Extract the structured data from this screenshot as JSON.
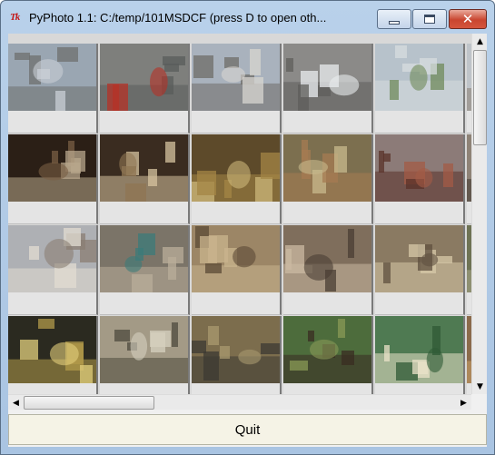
{
  "window": {
    "app_icon": "Tk",
    "title": "PyPhoto 1.1: C:/temp/101MSDCF  (press D to open oth...",
    "minimize_icon": "minimize-icon",
    "maximize_icon": "maximize-icon",
    "close_icon": "close-icon",
    "close_glyph": "✕"
  },
  "thumbnails": [
    {
      "row": 0,
      "col": 0,
      "subject": "london-aerial-skyline",
      "bg": "#9aa6b2",
      "fg": "#6e6f6e",
      "accent": "#c9cfd6"
    },
    {
      "row": 0,
      "col": 1,
      "subject": "street-with-red-buses",
      "bg": "#7e7f7c",
      "fg": "#5a5c5b",
      "accent": "#b53127"
    },
    {
      "row": 0,
      "col": 2,
      "subject": "bridge-over-thames",
      "bg": "#a9b2bd",
      "fg": "#6f6c68",
      "accent": "#d8d6d0"
    },
    {
      "row": 0,
      "col": 3,
      "subject": "aerial-rooftops",
      "bg": "#8b8a88",
      "fg": "#5f5d5b",
      "accent": "#e9ecef"
    },
    {
      "row": 0,
      "col": 4,
      "subject": "office-building-rooftop",
      "bg": "#b7c2cb",
      "fg": "#d7dcdf",
      "accent": "#6f8a5a"
    },
    {
      "row": 0,
      "col": 5,
      "subject": "street-buildings",
      "bg": "#bfc4c9",
      "fg": "#8a7f72",
      "accent": "#a63a2e"
    },
    {
      "row": 1,
      "col": 0,
      "subject": "museum-sculptures",
      "bg": "#2b1f16",
      "fg": "#b8a78c",
      "accent": "#7a5f44"
    },
    {
      "row": 1,
      "col": 1,
      "subject": "temple-columns",
      "bg": "#3a2c20",
      "fg": "#d6c39f",
      "accent": "#8f7653"
    },
    {
      "row": 1,
      "col": 2,
      "subject": "bronze-helmet",
      "bg": "#5d4a2a",
      "fg": "#a48645",
      "accent": "#cbb57a"
    },
    {
      "row": 1,
      "col": 3,
      "subject": "clay-pot-display",
      "bg": "#7c6f4f",
      "fg": "#a67b52",
      "accent": "#c8b98c"
    },
    {
      "row": 1,
      "col": 4,
      "subject": "stone-idol",
      "bg": "#8c7b78",
      "fg": "#5a3128",
      "accent": "#a35b46"
    },
    {
      "row": 1,
      "col": 5,
      "subject": "statue-gallery",
      "bg": "#8e8377",
      "fg": "#3f362f",
      "accent": "#c4b49c"
    },
    {
      "row": 2,
      "col": 0,
      "subject": "lion-statue",
      "bg": "#aeb0b4",
      "fg": "#e2dcd2",
      "accent": "#8a7e73"
    },
    {
      "row": 2,
      "col": 1,
      "subject": "mosaic-panels",
      "bg": "#7b7468",
      "fg": "#b9ad99",
      "accent": "#3b7b7a"
    },
    {
      "row": 2,
      "col": 2,
      "subject": "lion-mosaic",
      "bg": "#9c8666",
      "fg": "#c9b48e",
      "accent": "#5b4a36"
    },
    {
      "row": 2,
      "col": 3,
      "subject": "carved-stones-wall",
      "bg": "#7f6e5c",
      "fg": "#cbb9a2",
      "accent": "#4a3e33"
    },
    {
      "row": 2,
      "col": 4,
      "subject": "small-figurines",
      "bg": "#8a7a62",
      "fg": "#d7c9a8",
      "accent": "#5f503f"
    },
    {
      "row": 2,
      "col": 5,
      "subject": "relief-panel",
      "bg": "#6e7355",
      "fg": "#a9a88b",
      "accent": "#d8d2b8"
    },
    {
      "row": 3,
      "col": 0,
      "subject": "clay-cylinder",
      "bg": "#2b2a20",
      "fg": "#b29a4a",
      "accent": "#e2cf7c"
    },
    {
      "row": 3,
      "col": 1,
      "subject": "standing-figures",
      "bg": "#a39a86",
      "fg": "#4e4a3d",
      "accent": "#d6d0bf"
    },
    {
      "row": 3,
      "col": 2,
      "subject": "bronze-spearheads",
      "bg": "#7c6d4d",
      "fg": "#3c3a33",
      "accent": "#a99a6f"
    },
    {
      "row": 3,
      "col": 3,
      "subject": "horned-mask",
      "bg": "#4d6c3c",
      "fg": "#3a2c22",
      "accent": "#8a9a56"
    },
    {
      "row": 3,
      "col": 4,
      "subject": "coin-case",
      "bg": "#4f7a52",
      "fg": "#e9e2c8",
      "accent": "#2f5a36"
    },
    {
      "row": 3,
      "col": 5,
      "subject": "museum-cabinet",
      "bg": "#8b6a4b",
      "fg": "#caa06a",
      "accent": "#6a4733"
    }
  ],
  "scrollbars": {
    "up_arrow": "▲",
    "down_arrow": "▼",
    "left_arrow": "◀",
    "right_arrow": "▶"
  },
  "quit_button": {
    "label": "Quit"
  }
}
